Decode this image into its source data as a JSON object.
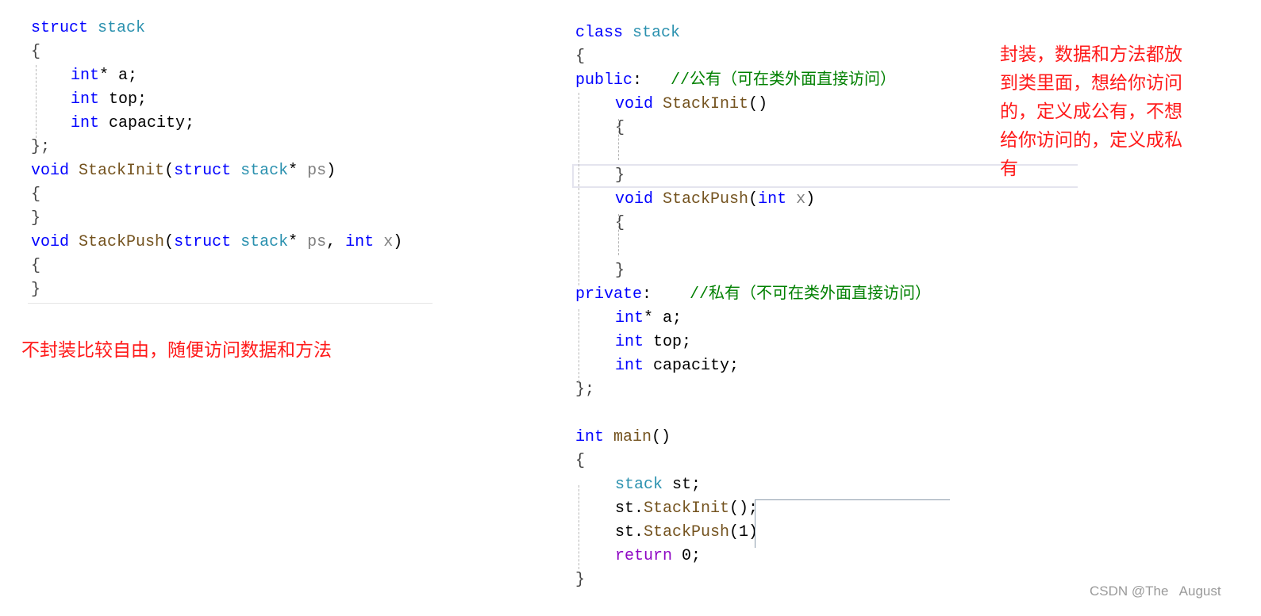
{
  "colors": {
    "keyword": "#0000ff",
    "type": "#2b91af",
    "function": "#74531f",
    "param": "#808080",
    "plain": "#000000",
    "comment": "#008000",
    "control": "#8f08c4",
    "brace": "#444444",
    "annotation": "#ff1a1a"
  },
  "left_code": {
    "lines": [
      {
        "indent": 0,
        "tokens": [
          {
            "t": "struct",
            "c": "keyword"
          },
          {
            "t": " ",
            "c": "plain"
          },
          {
            "t": "stack",
            "c": "type"
          }
        ]
      },
      {
        "indent": 0,
        "tokens": [
          {
            "t": "{",
            "c": "brace"
          }
        ]
      },
      {
        "indent": 1,
        "tokens": [
          {
            "t": "int",
            "c": "keyword"
          },
          {
            "t": "* a;",
            "c": "plain"
          }
        ]
      },
      {
        "indent": 1,
        "tokens": [
          {
            "t": "int",
            "c": "keyword"
          },
          {
            "t": " top;",
            "c": "plain"
          }
        ]
      },
      {
        "indent": 1,
        "tokens": [
          {
            "t": "int",
            "c": "keyword"
          },
          {
            "t": " capacity;",
            "c": "plain"
          }
        ]
      },
      {
        "indent": 0,
        "tokens": [
          {
            "t": "};",
            "c": "brace"
          }
        ]
      },
      {
        "indent": 0,
        "tokens": [
          {
            "t": "void",
            "c": "keyword"
          },
          {
            "t": " ",
            "c": "plain"
          },
          {
            "t": "StackInit",
            "c": "function"
          },
          {
            "t": "(",
            "c": "plain"
          },
          {
            "t": "struct",
            "c": "keyword"
          },
          {
            "t": " ",
            "c": "plain"
          },
          {
            "t": "stack",
            "c": "type"
          },
          {
            "t": "* ",
            "c": "plain"
          },
          {
            "t": "ps",
            "c": "param"
          },
          {
            "t": ")",
            "c": "plain"
          }
        ]
      },
      {
        "indent": 0,
        "tokens": [
          {
            "t": "{",
            "c": "brace"
          }
        ]
      },
      {
        "indent": 0,
        "tokens": [
          {
            "t": "}",
            "c": "brace"
          }
        ]
      },
      {
        "indent": 0,
        "tokens": [
          {
            "t": "void",
            "c": "keyword"
          },
          {
            "t": " ",
            "c": "plain"
          },
          {
            "t": "StackPush",
            "c": "function"
          },
          {
            "t": "(",
            "c": "plain"
          },
          {
            "t": "struct",
            "c": "keyword"
          },
          {
            "t": " ",
            "c": "plain"
          },
          {
            "t": "stack",
            "c": "type"
          },
          {
            "t": "* ",
            "c": "plain"
          },
          {
            "t": "ps",
            "c": "param"
          },
          {
            "t": ", ",
            "c": "plain"
          },
          {
            "t": "int",
            "c": "keyword"
          },
          {
            "t": " ",
            "c": "plain"
          },
          {
            "t": "x",
            "c": "param"
          },
          {
            "t": ")",
            "c": "plain"
          }
        ]
      },
      {
        "indent": 0,
        "tokens": [
          {
            "t": "{",
            "c": "brace"
          }
        ]
      },
      {
        "indent": 0,
        "tokens": [
          {
            "t": "}",
            "c": "brace"
          }
        ]
      }
    ]
  },
  "right_code": {
    "lines": [
      {
        "indent": 0,
        "tokens": [
          {
            "t": "class",
            "c": "keyword"
          },
          {
            "t": " ",
            "c": "plain"
          },
          {
            "t": "stack",
            "c": "type"
          }
        ]
      },
      {
        "indent": 0,
        "tokens": [
          {
            "t": "{",
            "c": "brace"
          }
        ]
      },
      {
        "indent": 0,
        "tokens": [
          {
            "t": "public",
            "c": "keyword"
          },
          {
            "t": ":   ",
            "c": "plain"
          },
          {
            "t": "//公有（可在类外面直接访问）",
            "c": "comment"
          }
        ]
      },
      {
        "indent": 1,
        "tokens": [
          {
            "t": "void",
            "c": "keyword"
          },
          {
            "t": " ",
            "c": "plain"
          },
          {
            "t": "StackInit",
            "c": "function"
          },
          {
            "t": "()",
            "c": "plain"
          }
        ]
      },
      {
        "indent": 1,
        "tokens": [
          {
            "t": "{",
            "c": "brace"
          }
        ]
      },
      {
        "indent": 1,
        "tokens": []
      },
      {
        "indent": 1,
        "tokens": [
          {
            "t": "}",
            "c": "brace"
          }
        ]
      },
      {
        "indent": 1,
        "tokens": [
          {
            "t": "void",
            "c": "keyword"
          },
          {
            "t": " ",
            "c": "plain"
          },
          {
            "t": "StackPush",
            "c": "function"
          },
          {
            "t": "(",
            "c": "plain"
          },
          {
            "t": "int",
            "c": "keyword"
          },
          {
            "t": " ",
            "c": "plain"
          },
          {
            "t": "x",
            "c": "param"
          },
          {
            "t": ")",
            "c": "plain"
          }
        ]
      },
      {
        "indent": 1,
        "tokens": [
          {
            "t": "{",
            "c": "brace"
          }
        ]
      },
      {
        "indent": 1,
        "tokens": []
      },
      {
        "indent": 1,
        "tokens": [
          {
            "t": "}",
            "c": "brace"
          }
        ]
      },
      {
        "indent": 0,
        "tokens": [
          {
            "t": "private",
            "c": "keyword"
          },
          {
            "t": ":    ",
            "c": "plain"
          },
          {
            "t": "//私有（不可在类外面直接访问）",
            "c": "comment"
          }
        ]
      },
      {
        "indent": 1,
        "tokens": [
          {
            "t": "int",
            "c": "keyword"
          },
          {
            "t": "* a;",
            "c": "plain"
          }
        ]
      },
      {
        "indent": 1,
        "tokens": [
          {
            "t": "int",
            "c": "keyword"
          },
          {
            "t": " top;",
            "c": "plain"
          }
        ]
      },
      {
        "indent": 1,
        "tokens": [
          {
            "t": "int",
            "c": "keyword"
          },
          {
            "t": " capacity;",
            "c": "plain"
          }
        ]
      },
      {
        "indent": 0,
        "tokens": [
          {
            "t": "};",
            "c": "brace"
          }
        ]
      },
      {
        "indent": 0,
        "tokens": []
      },
      {
        "indent": 0,
        "tokens": [
          {
            "t": "int",
            "c": "keyword"
          },
          {
            "t": " ",
            "c": "plain"
          },
          {
            "t": "main",
            "c": "function"
          },
          {
            "t": "()",
            "c": "plain"
          }
        ]
      },
      {
        "indent": 0,
        "tokens": [
          {
            "t": "{",
            "c": "brace"
          }
        ]
      },
      {
        "indent": 1,
        "tokens": [
          {
            "t": "stack",
            "c": "type"
          },
          {
            "t": " st;",
            "c": "plain"
          }
        ]
      },
      {
        "indent": 1,
        "tokens": [
          {
            "t": "st.",
            "c": "plain"
          },
          {
            "t": "StackInit",
            "c": "function"
          },
          {
            "t": "();",
            "c": "plain"
          }
        ]
      },
      {
        "indent": 1,
        "tokens": [
          {
            "t": "st.",
            "c": "plain"
          },
          {
            "t": "StackPush",
            "c": "function"
          },
          {
            "t": "(1)",
            "c": "plain"
          }
        ]
      },
      {
        "indent": 1,
        "tokens": [
          {
            "t": "return",
            "c": "control"
          },
          {
            "t": " 0;",
            "c": "plain"
          }
        ]
      },
      {
        "indent": 0,
        "tokens": [
          {
            "t": "}",
            "c": "brace"
          }
        ]
      }
    ]
  },
  "notes": {
    "left": "不封装比较自由，随便访问数据和方法",
    "right_lines": [
      "封装，数据和方法都放",
      "到类里面，想给你访问",
      "的，定义成公有，不想",
      "给你访问的，定义成私",
      "有"
    ]
  },
  "watermark": "CSDN @The   August"
}
